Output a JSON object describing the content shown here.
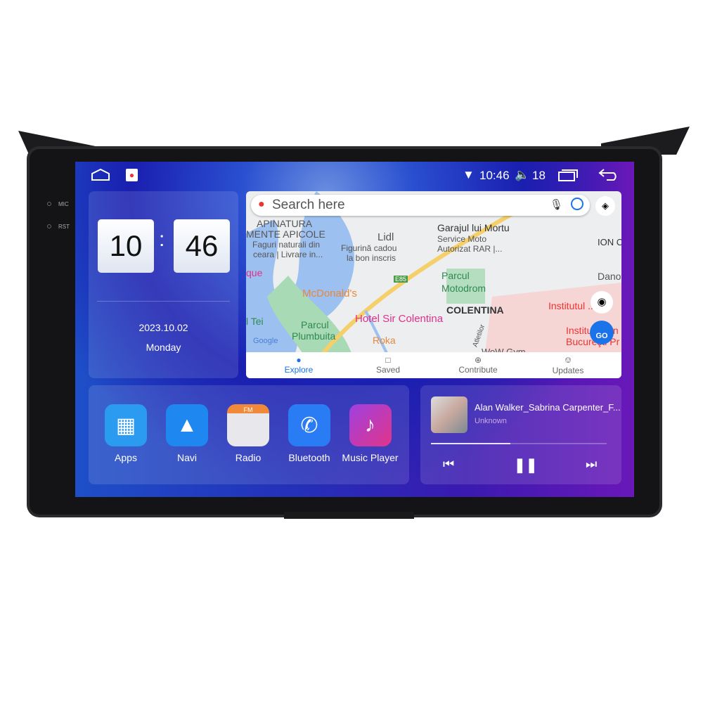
{
  "device": {
    "mic_label": "MIC",
    "rst_label": "RST"
  },
  "status_bar": {
    "time": "10:46",
    "volume": "18",
    "icons": [
      "home-icon",
      "maps-icon",
      "wifi-icon",
      "volume-icon",
      "recents-icon",
      "back-icon"
    ]
  },
  "clock": {
    "hours": "10",
    "separator": ":",
    "minutes": "46",
    "date": "2023.10.02",
    "weekday": "Monday"
  },
  "maps": {
    "search_placeholder": "Search here",
    "go_label": "GO",
    "google_logo": "Google",
    "labels": [
      "APINATURA",
      "MENTE APICOLE",
      "Faguri naturali din",
      "ceara | Livrare in...",
      "Lidl",
      "Figurină cadou",
      "la bon inscris",
      "Garajul lui Mortu",
      "Service Moto",
      "Autorizat RAR |...",
      "ION C",
      "que",
      "Parcul",
      "Motodrom",
      "Dano",
      "McDonald's",
      "COLENTINA",
      "Institutul ...c",
      "l Tei",
      "Hotel Sir Colentina",
      "Parcul",
      "Plumbuita",
      "Institutul On",
      "Bucureşti Pr",
      "Roka",
      "E85",
      "Atletilor",
      "WoW Gym"
    ],
    "tabs": [
      {
        "label": "Explore",
        "active": true
      },
      {
        "label": "Saved"
      },
      {
        "label": "Contribute"
      },
      {
        "label": "Updates"
      }
    ]
  },
  "apps": [
    {
      "label": "Apps",
      "icon": "apps-icon",
      "color": "#2a9bf0"
    },
    {
      "label": "Navi",
      "icon": "navigation-icon",
      "color": "#1e88f0"
    },
    {
      "label": "Radio",
      "icon": "radio-icon",
      "color": "#e8e8ec",
      "badge": "FM"
    },
    {
      "label": "Bluetooth",
      "icon": "bluetooth-phone-icon",
      "color": "#2a7cf5"
    },
    {
      "label": "Music Player",
      "icon": "music-note-icon",
      "color": "#e0358a"
    }
  ],
  "music": {
    "title": "Alan Walker_Sabrina Carpenter_F...",
    "artist": "Unknown",
    "progress_percent": 45
  }
}
